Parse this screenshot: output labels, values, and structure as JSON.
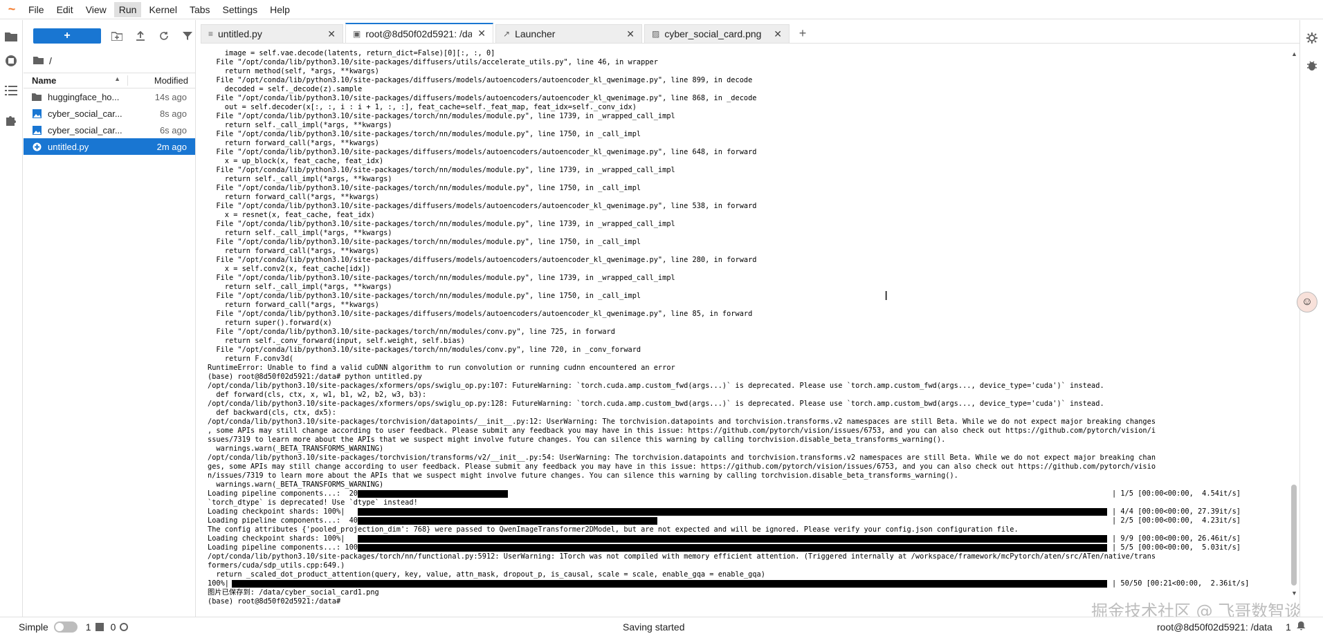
{
  "menubar": {
    "logo": "~",
    "items": [
      "File",
      "Edit",
      "View",
      "Run",
      "Kernel",
      "Tabs",
      "Settings",
      "Help"
    ],
    "active": "Run"
  },
  "filebrowser": {
    "new_label": "+",
    "breadcrumb": "/",
    "header": {
      "name": "Name",
      "modified": "Modified"
    },
    "files": [
      {
        "name": "huggingface_ho...",
        "modified": "14s ago",
        "type": "folder"
      },
      {
        "name": "cyber_social_car...",
        "modified": "8s ago",
        "type": "image"
      },
      {
        "name": "cyber_social_car...",
        "modified": "6s ago",
        "type": "image"
      },
      {
        "name": "untitled.py",
        "modified": "2m ago",
        "type": "python"
      }
    ]
  },
  "tabs": [
    {
      "label": "untitled.py",
      "icon": "≡"
    },
    {
      "label": "root@8d50f02d5921: /data",
      "icon": "▣"
    },
    {
      "label": "Launcher",
      "icon": "↗"
    },
    {
      "label": "cyber_social_card.png",
      "icon": "▨"
    }
  ],
  "terminal": {
    "lines": [
      "    image = self.vae.decode(latents, return_dict=False)[0][:, :, 0]",
      "  File \"/opt/conda/lib/python3.10/site-packages/diffusers/utils/accelerate_utils.py\", line 46, in wrapper",
      "    return method(self, *args, **kwargs)",
      "  File \"/opt/conda/lib/python3.10/site-packages/diffusers/models/autoencoders/autoencoder_kl_qwenimage.py\", line 899, in decode",
      "    decoded = self._decode(z).sample",
      "  File \"/opt/conda/lib/python3.10/site-packages/diffusers/models/autoencoders/autoencoder_kl_qwenimage.py\", line 868, in _decode",
      "    out = self.decoder(x[:, :, i : i + 1, :, :], feat_cache=self._feat_map, feat_idx=self._conv_idx)",
      "  File \"/opt/conda/lib/python3.10/site-packages/torch/nn/modules/module.py\", line 1739, in _wrapped_call_impl",
      "    return self._call_impl(*args, **kwargs)",
      "  File \"/opt/conda/lib/python3.10/site-packages/torch/nn/modules/module.py\", line 1750, in _call_impl",
      "    return forward_call(*args, **kwargs)",
      "  File \"/opt/conda/lib/python3.10/site-packages/diffusers/models/autoencoders/autoencoder_kl_qwenimage.py\", line 648, in forward",
      "    x = up_block(x, feat_cache, feat_idx)",
      "  File \"/opt/conda/lib/python3.10/site-packages/torch/nn/modules/module.py\", line 1739, in _wrapped_call_impl",
      "    return self._call_impl(*args, **kwargs)",
      "  File \"/opt/conda/lib/python3.10/site-packages/torch/nn/modules/module.py\", line 1750, in _call_impl",
      "    return forward_call(*args, **kwargs)",
      "  File \"/opt/conda/lib/python3.10/site-packages/diffusers/models/autoencoders/autoencoder_kl_qwenimage.py\", line 538, in forward",
      "    x = resnet(x, feat_cache, feat_idx)",
      "  File \"/opt/conda/lib/python3.10/site-packages/torch/nn/modules/module.py\", line 1739, in _wrapped_call_impl",
      "    return self._call_impl(*args, **kwargs)",
      "  File \"/opt/conda/lib/python3.10/site-packages/torch/nn/modules/module.py\", line 1750, in _call_impl",
      "    return forward_call(*args, **kwargs)",
      "  File \"/opt/conda/lib/python3.10/site-packages/diffusers/models/autoencoders/autoencoder_kl_qwenimage.py\", line 280, in forward",
      "    x = self.conv2(x, feat_cache[idx])",
      "  File \"/opt/conda/lib/python3.10/site-packages/torch/nn/modules/module.py\", line 1739, in _wrapped_call_impl",
      "    return self._call_impl(*args, **kwargs)",
      "  File \"/opt/conda/lib/python3.10/site-packages/torch/nn/modules/module.py\", line 1750, in _call_impl",
      "    return forward_call(*args, **kwargs)",
      "  File \"/opt/conda/lib/python3.10/site-packages/diffusers/models/autoencoders/autoencoder_kl_qwenimage.py\", line 85, in forward",
      "    return super().forward(x)",
      "  File \"/opt/conda/lib/python3.10/site-packages/torch/nn/modules/conv.py\", line 725, in forward",
      "    return self._conv_forward(input, self.weight, self.bias)",
      "  File \"/opt/conda/lib/python3.10/site-packages/torch/nn/modules/conv.py\", line 720, in _conv_forward",
      "    return F.conv3d(",
      "RuntimeError: Unable to find a valid cuDNN algorithm to run convolution or running cudnn encountered an error",
      "(base) root@8d50f02d5921:/data# python untitled.py",
      "/opt/conda/lib/python3.10/site-packages/xformers/ops/swiglu_op.py:107: FutureWarning: `torch.cuda.amp.custom_fwd(args...)` is deprecated. Please use `torch.amp.custom_fwd(args..., device_type='cuda')` instead.",
      "  def forward(cls, ctx, x, w1, b1, w2, b2, w3, b3):",
      "/opt/conda/lib/python3.10/site-packages/xformers/ops/swiglu_op.py:128: FutureWarning: `torch.cuda.amp.custom_bwd(args...)` is deprecated. Please use `torch.amp.custom_bwd(args..., device_type='cuda')` instead.",
      "  def backward(cls, ctx, dx5):",
      "/opt/conda/lib/python3.10/site-packages/torchvision/datapoints/__init__.py:12: UserWarning: The torchvision.datapoints and torchvision.transforms.v2 namespaces are still Beta. While we do not expect major breaking changes",
      ", some APIs may still change according to user feedback. Please submit any feedback you may have in this issue: https://github.com/pytorch/vision/issues/6753, and you can also check out https://github.com/pytorch/vision/i",
      "ssues/7319 to learn more about the APIs that we suspect might involve future changes. You can silence this warning by calling torchvision.disable_beta_transforms_warning().",
      "  warnings.warn(_BETA_TRANSFORMS_WARNING)",
      "/opt/conda/lib/python3.10/site-packages/torchvision/transforms/v2/__init__.py:54: UserWarning: The torchvision.datapoints and torchvision.transforms.v2 namespaces are still Beta. While we do not expect major breaking chan",
      "ges, some APIs may still change according to user feedback. Please submit any feedback you may have in this issue: https://github.com/pytorch/vision/issues/6753, and you can also check out https://github.com/pytorch/visio",
      "n/issues/7319 to learn more about the APIs that we suspect might involve future changes. You can silence this warning by calling torchvision.disable_beta_transforms_warning().",
      "  warnings.warn(_BETA_TRANSFORMS_WARNING)"
    ],
    "progress": [
      {
        "prefix": "Loading pipeline components...:  20%|",
        "fraction": 0.2,
        "suffix": "| 1/5 [00:00<00:00,  4.54it/s]"
      },
      {
        "text": "`torch_dtype` is deprecated! Use `dtype` instead!"
      },
      {
        "prefix": "Loading checkpoint shards: 100%|",
        "fraction": 1.0,
        "suffix": "| 4/4 [00:00<00:00, 27.39it/s]"
      },
      {
        "prefix": "Loading pipeline components...:  40%|",
        "fraction": 0.4,
        "suffix": "| 2/5 [00:00<00:00,  4.23it/s]"
      },
      {
        "text": "The config attributes {'pooled_projection_dim': 768} were passed to QwenImageTransformer2DModel, but are not expected and will be ignored. Please verify your config.json configuration file."
      },
      {
        "prefix": "Loading checkpoint shards: 100%|",
        "fraction": 1.0,
        "suffix": "| 9/9 [00:00<00:00, 26.46it/s]"
      },
      {
        "prefix": "Loading pipeline components...: 100%|",
        "fraction": 1.0,
        "suffix": "| 5/5 [00:00<00:00,  5.03it/s]"
      },
      {
        "text": "/opt/conda/lib/python3.10/site-packages/torch/nn/functional.py:5912: UserWarning: 1Torch was not compiled with memory efficient attention. (Triggered internally at /workspace/framework/mcPytorch/aten/src/ATen/native/trans"
      },
      {
        "text": "formers/cuda/sdp_utils.cpp:649.)"
      },
      {
        "text": "  return _scaled_dot_product_attention(query, key, value, attn_mask, dropout_p, is_causal, scale = scale, enable_gqa = enable_gqa)"
      },
      {
        "prefix": "100%|",
        "fraction": 1.0,
        "suffix": "| 50/50 [00:21<00:00,  2.36it/s]"
      },
      {
        "text": "图片已保存到: /data/cyber_social_card1.png"
      },
      {
        "text": "(base) root@8d50f02d5921:/data# "
      }
    ]
  },
  "statusbar": {
    "mode": "Simple",
    "terminals": "1",
    "kernels": "0",
    "status": "Saving started",
    "terminal_name": "root@8d50f02d5921: /data",
    "notifications": "1"
  },
  "watermark": "掘金技术社区 @ 飞哥数智谈",
  "colors": {
    "accent": "#1976d2",
    "logo": "#f37726"
  }
}
